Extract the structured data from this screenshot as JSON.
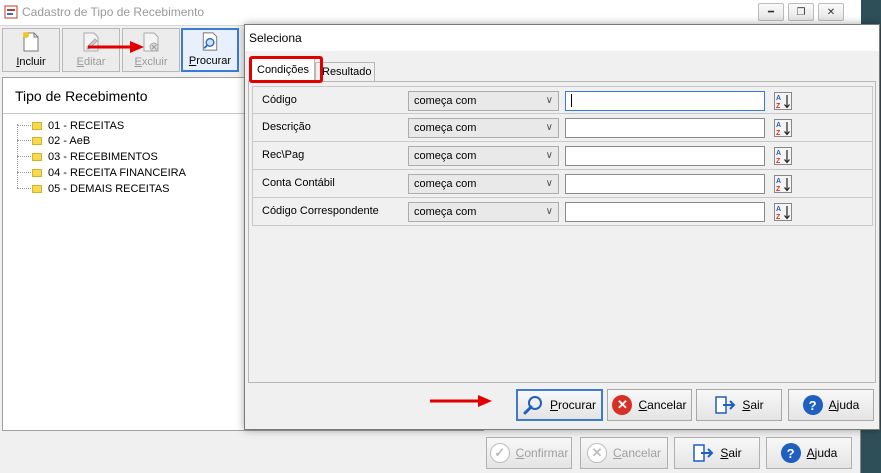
{
  "main_window": {
    "title": "Cadastro de Tipo de Recebimento",
    "toolbar": {
      "incluir": {
        "label": "Incluir",
        "underline": "I",
        "rest": "ncluir",
        "enabled": true
      },
      "editar": {
        "label": "Editar",
        "underline": "E",
        "rest": "ditar",
        "enabled": false
      },
      "excluir": {
        "label": "Excluir",
        "underline": "E",
        "rest": "xcluir",
        "enabled": false
      },
      "procurar": {
        "label": "Procurar",
        "underline": "P",
        "rest": "rocurar",
        "enabled": true
      }
    },
    "tree": {
      "header": "Tipo de Recebimento",
      "items": [
        "01 - RECEITAS",
        "02 - AeB",
        "03 - RECEBIMENTOS",
        "04 - RECEITA FINANCEIRA",
        "05 - DEMAIS RECEITAS"
      ]
    },
    "bottom_buttons": {
      "confirmar": {
        "underline": "C",
        "rest": "onfirmar"
      },
      "cancelar": {
        "underline": "C",
        "rest": "ancelar"
      },
      "sair": {
        "underline": "S",
        "rest": "air"
      },
      "ajuda": {
        "underline": "A",
        "rest": "juda"
      }
    }
  },
  "dialog": {
    "title": "Seleciona",
    "tabs": {
      "condicoes": "Condições",
      "resultado": "Resultado"
    },
    "conditions": [
      {
        "label": "Código",
        "operator": "começa com",
        "value": ""
      },
      {
        "label": "Descrição",
        "operator": "começa com",
        "value": ""
      },
      {
        "label": "Rec\\Pag",
        "operator": "começa com",
        "value": ""
      },
      {
        "label": "Conta Contábil",
        "operator": "começa com",
        "value": ""
      },
      {
        "label": "Código Correspondente",
        "operator": "começa com",
        "value": ""
      }
    ],
    "footer_buttons": {
      "procurar": {
        "underline": "P",
        "rest": "rocurar"
      },
      "cancelar": {
        "underline": "C",
        "rest": "ancelar"
      },
      "sair": {
        "underline": "S",
        "rest": "air"
      },
      "ajuda": {
        "underline": "A",
        "rest": "juda"
      }
    }
  },
  "colors": {
    "annotation_red": "#e00000",
    "focus_blue": "#3d7bd1",
    "cancel_red": "#d93025",
    "help_blue": "#1f5fbf"
  }
}
